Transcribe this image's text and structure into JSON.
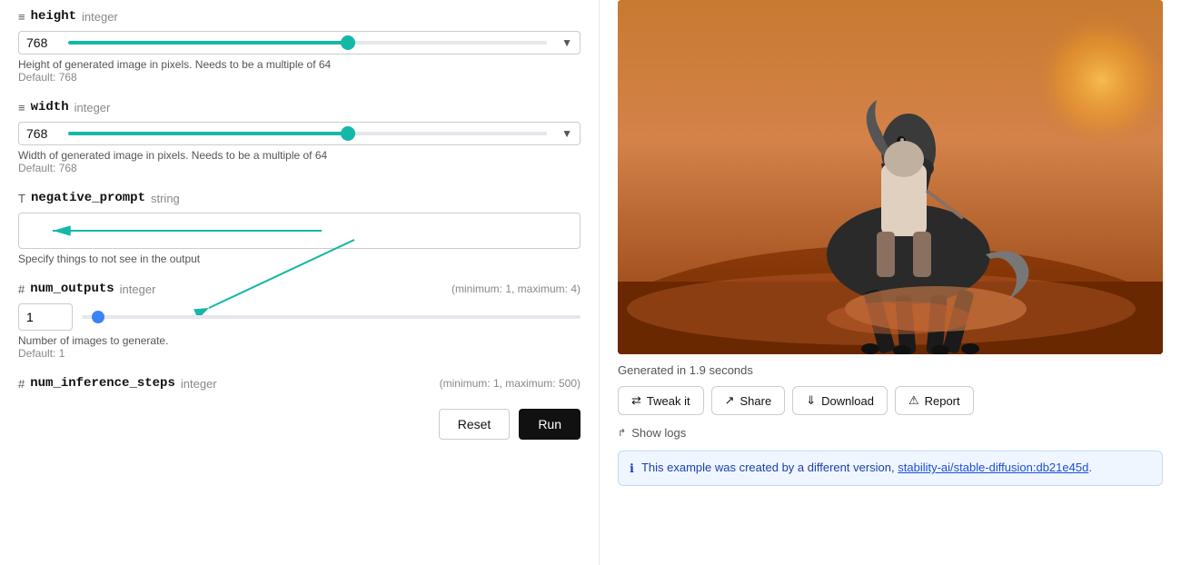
{
  "fields": {
    "height": {
      "icon": "≡",
      "name": "height",
      "type": "integer",
      "value": "768",
      "fill_pct": 60,
      "desc": "Height of generated image in pixels. Needs to be a multiple of 64",
      "default": "Default: 768"
    },
    "width": {
      "icon": "≡",
      "name": "width",
      "type": "integer",
      "value": "768",
      "fill_pct": 60,
      "desc": "Width of generated image in pixels. Needs to be a multiple of 64",
      "default": "Default: 768"
    },
    "negative_prompt": {
      "icon": "T",
      "name": "negative_prompt",
      "type": "string",
      "value": "",
      "desc": "Specify things to not see in the output"
    },
    "num_outputs": {
      "icon": "#",
      "name": "num_outputs",
      "type": "integer",
      "hint": "(minimum: 1, maximum: 4)",
      "value": "1",
      "desc": "Number of images to generate.",
      "default": "Default: 1"
    },
    "num_inference_steps": {
      "icon": "#",
      "name": "num_inference_steps",
      "type": "integer",
      "hint": "(minimum: 1, maximum: 500)"
    }
  },
  "buttons": {
    "reset": "Reset",
    "run": "Run"
  },
  "right": {
    "gen_time": "Generated in 1.9 seconds",
    "tweak_label": "Tweak it",
    "share_label": "Share",
    "download_label": "Download",
    "report_label": "Report",
    "show_logs_label": "Show logs",
    "info_text": "This example was created by a different version, ",
    "info_link": "stability-ai/stable-diffusion:db21e45d",
    "info_link_url": "#"
  }
}
